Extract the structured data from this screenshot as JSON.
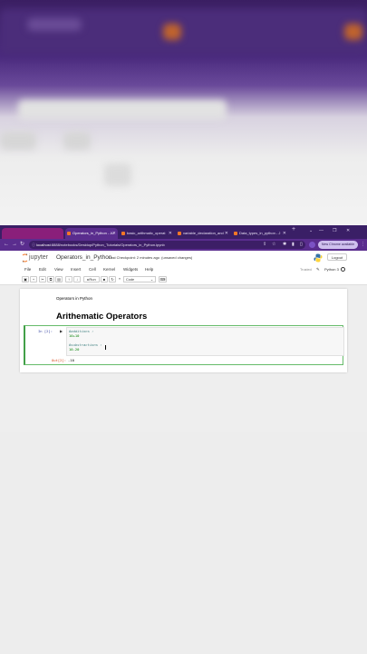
{
  "browser": {
    "tabs": [
      {
        "label": "Operators_in_Python - Ju",
        "active": true
      },
      {
        "label": "basic_arithmatic_operat",
        "active": false
      },
      {
        "label": "variable_declaration_and",
        "active": false
      },
      {
        "label": "Data_types_in_python - J",
        "active": false
      }
    ],
    "new_tab": "+",
    "url_host": "localhost",
    "url_path": ":8888/notebooks/Desktop/Python_Tutorials/Operators_in_Python.ipynb",
    "update_button": "New Chrome available",
    "accent_color": "#5a2d8e"
  },
  "jupyter": {
    "logo_text": "jupyter",
    "notebook_name": "Operators_in_Python",
    "checkpoint": "Last Checkpoint: 2 minutes ago",
    "unsaved": "(unsaved changes)",
    "logout": "Logout",
    "menu": [
      "File",
      "Edit",
      "View",
      "Insert",
      "Cell",
      "Kernel",
      "Widgets",
      "Help"
    ],
    "trusted": "Trusted",
    "kernel": "Python 3",
    "toolbar": {
      "run_label": "Run",
      "cell_type": "Code"
    }
  },
  "notebook": {
    "markdown_text": "Operators in Python",
    "heading": "Arithematic Operators",
    "code_cell": {
      "prompt": "In [2]:",
      "lines": [
        "#additions :",
        "10+10",
        "",
        "#substractions :",
        "10-20"
      ],
      "out_prompt": "Out[2]:",
      "output": "-10"
    }
  }
}
